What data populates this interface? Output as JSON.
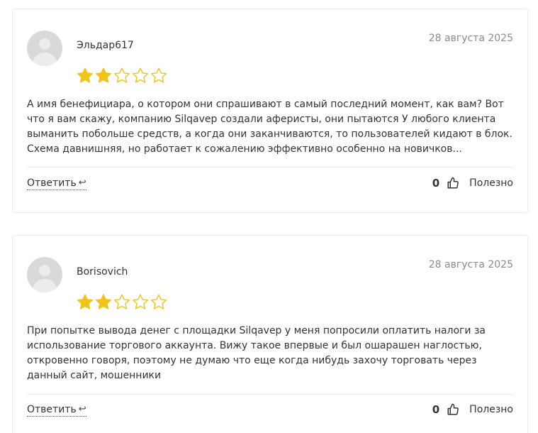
{
  "reviews": [
    {
      "author": "Эльдар617",
      "date": "28 августа 2025",
      "rating": 2,
      "max_rating": 5,
      "text": "А имя бенефициара, о котором они спрашивают в самый последний момент, как вам? Вот что я вам скажу, компанию Silqavep создали аферисты, они пытаются У любого клиента выманить побольше средств, а когда они заканчиваются, то пользователей кидают в блок. Схема давнишняя, но работает к сожалению эффективно особенно на новичков...",
      "reply_label": "Ответить",
      "votes": "0",
      "useful_label": "Полезно"
    },
    {
      "author": "Borisovich",
      "date": "28 августа 2025",
      "rating": 2,
      "max_rating": 5,
      "text": "При попытке вывода денег с площадки Silqavep у меня попросили оплатить налоги за использование торгового аккаунта. Вижу такое впервые и был ошарашен наглостью, откровенно говоря, поэтому не думаю что еще когда нибудь захочу торговать через данный сайт, мошенники",
      "reply_label": "Ответить",
      "votes": "0",
      "useful_label": "Полезно"
    }
  ],
  "icons": {
    "star_filled": "star-filled-icon",
    "star_empty": "star-outline-icon",
    "reply": "reply-arrow-icon",
    "thumb": "thumbs-up-icon",
    "avatar": "default-avatar-icon"
  },
  "colors": {
    "star": "#f0c419",
    "border": "#ececec",
    "date": "#8a8a8a",
    "text": "#333333"
  }
}
